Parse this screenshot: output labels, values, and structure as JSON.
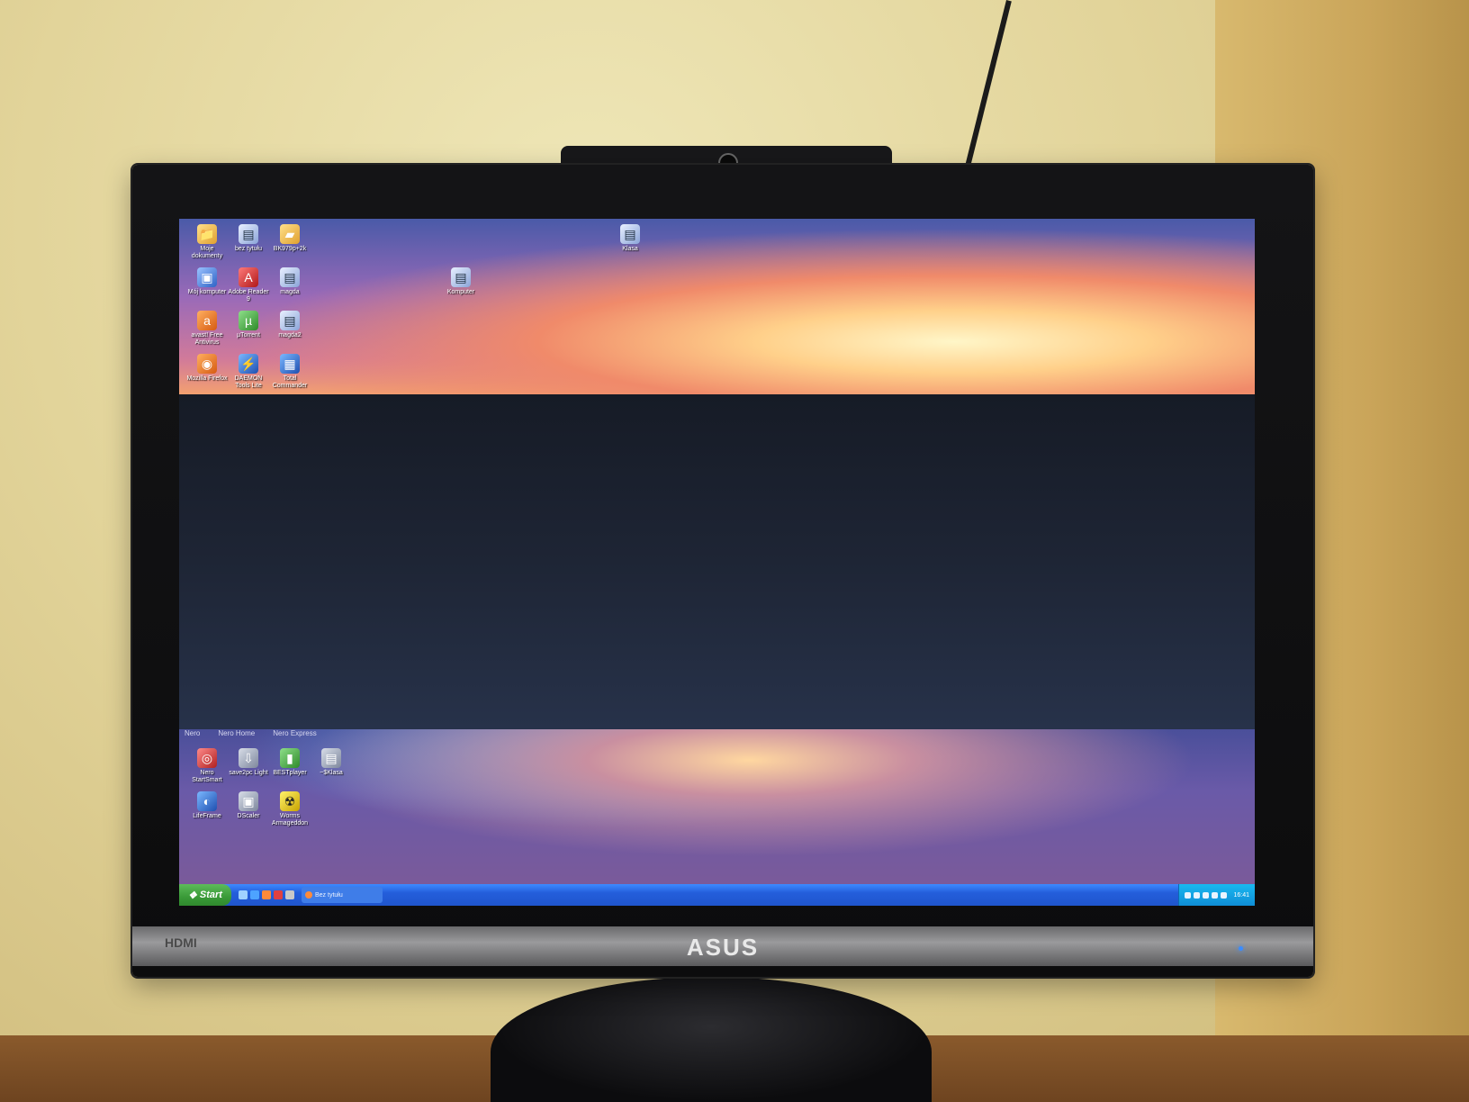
{
  "monitor": {
    "brand": "ASUS",
    "port_label": "HDMI"
  },
  "desktop": {
    "top_icons": [
      {
        "label": "Moje dokumenty",
        "icon": "my-documents-icon",
        "glyph": "📁",
        "style": "g-folder"
      },
      {
        "label": "bez tytułu",
        "icon": "document-icon",
        "glyph": "▤",
        "style": "g-doc"
      },
      {
        "label": "BK979p+2k",
        "icon": "folder-icon",
        "glyph": "▰",
        "style": "g-folder"
      },
      {
        "label": "Mój komputer",
        "icon": "my-computer-icon",
        "glyph": "▣",
        "style": "g-pc"
      },
      {
        "label": "Adobe Reader 9",
        "icon": "adobe-reader-icon",
        "glyph": "A",
        "style": "g-pdf"
      },
      {
        "label": "magda",
        "icon": "document-icon",
        "glyph": "▤",
        "style": "g-doc"
      },
      {
        "label": "avast! Free Antivirus",
        "icon": "avast-icon",
        "glyph": "a",
        "style": "g-orange"
      },
      {
        "label": "µTorrent",
        "icon": "utorrent-icon",
        "glyph": "µ",
        "style": "g-green"
      },
      {
        "label": "magda2",
        "icon": "document-icon",
        "glyph": "▤",
        "style": "g-doc"
      },
      {
        "label": "Mozilla Firefox",
        "icon": "firefox-icon",
        "glyph": "◉",
        "style": "g-orange"
      },
      {
        "label": "DAEMON Tools Lite",
        "icon": "daemon-tools-icon",
        "glyph": "⚡",
        "style": "g-blue"
      },
      {
        "label": "Total Commander",
        "icon": "total-commander-icon",
        "glyph": "▦",
        "style": "g-blue"
      }
    ],
    "extra_icons": [
      {
        "label": "Klasa",
        "icon": "document-icon",
        "glyph": "▤",
        "style": "g-doc"
      },
      {
        "label": "Komputer",
        "icon": "document-icon",
        "glyph": "▤",
        "style": "g-doc"
      }
    ],
    "bottom_links": [
      "Nero",
      "Nero Home",
      "Nero Express"
    ],
    "bottom_icons": [
      {
        "label": "Nero StartSmart",
        "icon": "nero-icon",
        "glyph": "◎",
        "style": "g-red"
      },
      {
        "label": "save2pc Light",
        "icon": "save2pc-icon",
        "glyph": "⇩",
        "style": "g-gray"
      },
      {
        "label": "BESTplayer",
        "icon": "player-icon",
        "glyph": "▮",
        "style": "g-green"
      },
      {
        "label": "~$Klasa",
        "icon": "document-icon",
        "glyph": "▤",
        "style": "g-gray"
      },
      {
        "label": "LifeFrame",
        "icon": "lifeframe-icon",
        "glyph": "◐",
        "style": "g-blue"
      },
      {
        "label": "DScaler",
        "icon": "dscaler-icon",
        "glyph": "▣",
        "style": "g-gray"
      },
      {
        "label": "Worms Armageddon",
        "icon": "worms-icon",
        "glyph": "☢",
        "style": "g-yellow"
      }
    ]
  },
  "taskbar": {
    "start_label": "Start",
    "task_button": "Bez tytułu",
    "clock": "16:41"
  }
}
